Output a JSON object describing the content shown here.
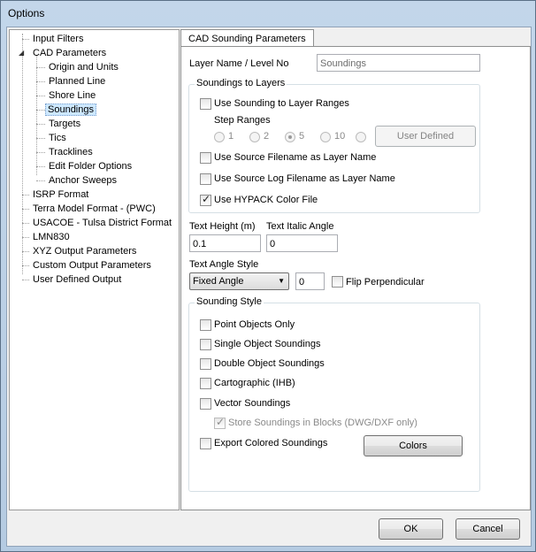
{
  "window": {
    "title": "Options"
  },
  "tree": {
    "items": [
      {
        "label": "Input Filters",
        "level": 0
      },
      {
        "label": "CAD Parameters",
        "level": 0,
        "expanded": true
      },
      {
        "label": "Origin and Units",
        "level": 1
      },
      {
        "label": "Planned Line",
        "level": 1
      },
      {
        "label": "Shore Line",
        "level": 1
      },
      {
        "label": "Soundings",
        "level": 1,
        "selected": true
      },
      {
        "label": "Targets",
        "level": 1
      },
      {
        "label": "Tics",
        "level": 1
      },
      {
        "label": "Tracklines",
        "level": 1
      },
      {
        "label": "Edit Folder Options",
        "level": 1
      },
      {
        "label": "Anchor Sweeps",
        "level": 1
      },
      {
        "label": "ISRP Format",
        "level": 0
      },
      {
        "label": "Terra Model Format - (PWC)",
        "level": 0
      },
      {
        "label": "USACOE - Tulsa District Format",
        "level": 0
      },
      {
        "label": "LMN830",
        "level": 0
      },
      {
        "label": "XYZ Output Parameters",
        "level": 0
      },
      {
        "label": "Custom Output Parameters",
        "level": 0
      },
      {
        "label": "User Defined Output",
        "level": 0
      }
    ]
  },
  "tab": {
    "label": "CAD Sounding Parameters"
  },
  "layer": {
    "label": "Layer Name / Level No",
    "value": "Soundings"
  },
  "layers_group": {
    "title": "Soundings to Layers",
    "use_ranges": "Use Sounding to Layer Ranges",
    "step_ranges": "Step Ranges",
    "radios": [
      "1",
      "2",
      "5",
      "10"
    ],
    "selected_radio": "5",
    "user_defined": "User Defined",
    "src_filename": "Use Source Filename as Layer Name",
    "src_log": "Use Source Log Filename as Layer Name",
    "hypack_color": "Use HYPACK Color File"
  },
  "text": {
    "height_label": "Text Height (m)",
    "height_value": "0.1",
    "italic_label": "Text Italic Angle",
    "italic_value": "0",
    "angle_style_label": "Text Angle Style",
    "angle_style_value": "Fixed Angle",
    "angle_value": "0",
    "flip": "Flip Perpendicular"
  },
  "style_group": {
    "title": "Sounding Style",
    "point_objects": "Point Objects Only",
    "single_object": "Single Object Soundings",
    "double_object": "Double Object Soundings",
    "cartographic": "Cartographic (IHB)",
    "vector": "Vector Soundings",
    "store_blocks": "Store Soundings in Blocks (DWG/DXF only)",
    "export_colored": "Export Colored Soundings",
    "colors_button": "Colors"
  },
  "footer": {
    "ok": "OK",
    "cancel": "Cancel"
  }
}
